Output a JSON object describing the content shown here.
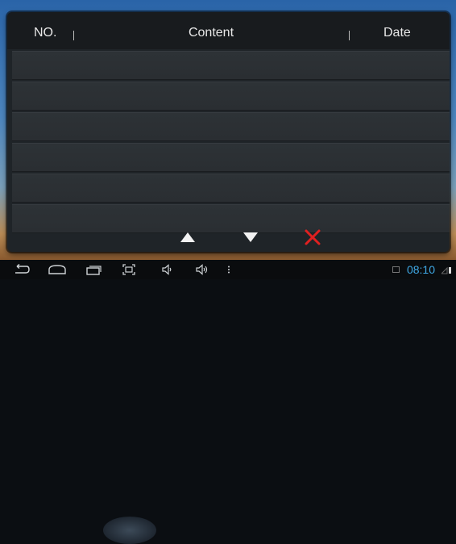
{
  "table": {
    "columns": {
      "no": "NO.",
      "content": "Content",
      "date": "Date"
    },
    "rows": [
      {
        "no": "",
        "content": "",
        "date": ""
      },
      {
        "no": "",
        "content": "",
        "date": ""
      },
      {
        "no": "",
        "content": "",
        "date": ""
      },
      {
        "no": "",
        "content": "",
        "date": ""
      },
      {
        "no": "",
        "content": "",
        "date": ""
      },
      {
        "no": "",
        "content": "",
        "date": ""
      }
    ]
  },
  "controls": {
    "up_icon": "triangle-up-icon",
    "down_icon": "triangle-down-icon",
    "delete_icon": "close-icon",
    "delete_color": "#e02020",
    "arrow_color": "#f2f2f2"
  },
  "navbar": {
    "items": [
      "back-icon",
      "home-icon",
      "recent-apps-icon",
      "screenshot-icon",
      "volume-down-icon",
      "volume-up-icon",
      "menu-icon"
    ],
    "clock": "08:10",
    "clock_color": "#3fa9e6"
  }
}
